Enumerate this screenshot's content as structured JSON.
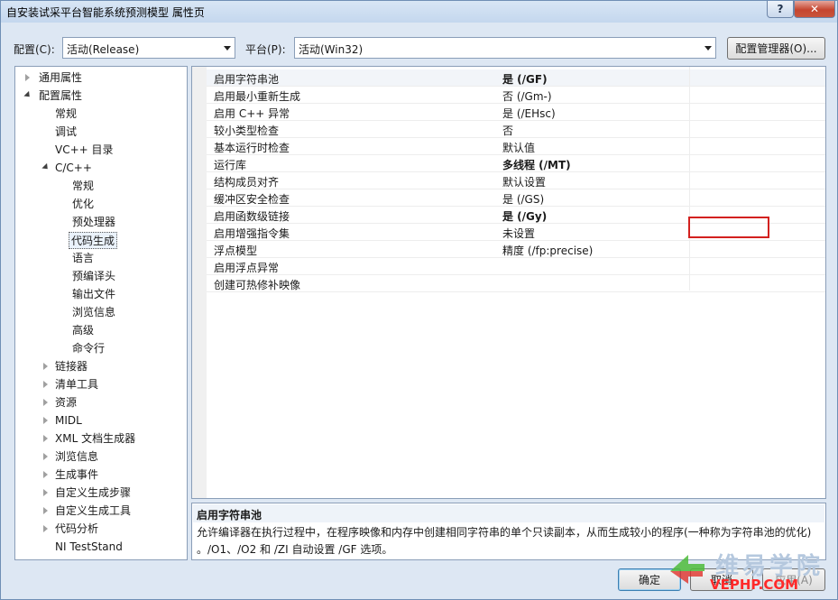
{
  "window": {
    "title": "自安装试采平台智能系统预测模型 属性页",
    "help_label": "?",
    "close_label": "✕"
  },
  "toolbar": {
    "config_label": "配置(C):",
    "config_value": "活动(Release)",
    "platform_label": "平台(P):",
    "platform_value": "活动(Win32)",
    "config_manager_label": "配置管理器(O)..."
  },
  "tree": {
    "items": [
      {
        "label": "通用属性"
      },
      {
        "label": "配置属性"
      },
      {
        "label": "常规"
      },
      {
        "label": "调试"
      },
      {
        "label": "VC++ 目录"
      },
      {
        "label": "C/C++"
      },
      {
        "label": "常规"
      },
      {
        "label": "优化"
      },
      {
        "label": "预处理器"
      },
      {
        "label": "代码生成"
      },
      {
        "label": "语言"
      },
      {
        "label": "预编译头"
      },
      {
        "label": "输出文件"
      },
      {
        "label": "浏览信息"
      },
      {
        "label": "高级"
      },
      {
        "label": "命令行"
      },
      {
        "label": "链接器"
      },
      {
        "label": "清单工具"
      },
      {
        "label": "资源"
      },
      {
        "label": "MIDL"
      },
      {
        "label": "XML 文档生成器"
      },
      {
        "label": "浏览信息"
      },
      {
        "label": "生成事件"
      },
      {
        "label": "自定义生成步骤"
      },
      {
        "label": "自定义生成工具"
      },
      {
        "label": "代码分析"
      },
      {
        "label": "NI TestStand"
      }
    ]
  },
  "properties": {
    "rows": [
      {
        "name": "启用字符串池",
        "value": "是 (/GF)"
      },
      {
        "name": "启用最小重新生成",
        "value": "否 (/Gm-)"
      },
      {
        "name": "启用 C++ 异常",
        "value": "是 (/EHsc)"
      },
      {
        "name": "较小类型检查",
        "value": "否"
      },
      {
        "name": "基本运行时检查",
        "value": "默认值"
      },
      {
        "name": "运行库",
        "value": "多线程 (/MT)"
      },
      {
        "name": "结构成员对齐",
        "value": "默认设置"
      },
      {
        "name": "缓冲区安全检查",
        "value": "是 (/GS)"
      },
      {
        "name": "启用函数级链接",
        "value": "是 (/Gy)"
      },
      {
        "name": "启用增强指令集",
        "value": "未设置"
      },
      {
        "name": "浮点模型",
        "value": "精度 (/fp:precise)"
      },
      {
        "name": "启用浮点异常",
        "value": ""
      },
      {
        "name": "创建可热修补映像",
        "value": ""
      }
    ]
  },
  "description": {
    "title": "启用字符串池",
    "line1": "允许编译器在执行过程中，在程序映像和内存中创建相同字符串的单个只读副本，从而生成较小的程序(一种称为字符串池的优化)",
    "line2": "。/O1、/O2 和 /ZI 自动设置 /GF 选项。"
  },
  "buttons": {
    "ok_label": "确定",
    "cancel_label": "取消",
    "apply_label": "应用(A)"
  },
  "watermark": {
    "cn": "维易学院",
    "en": "VEPHP.COM"
  },
  "colors": {
    "highlight_box": "#d3211f",
    "close_button": "#c5452f"
  }
}
